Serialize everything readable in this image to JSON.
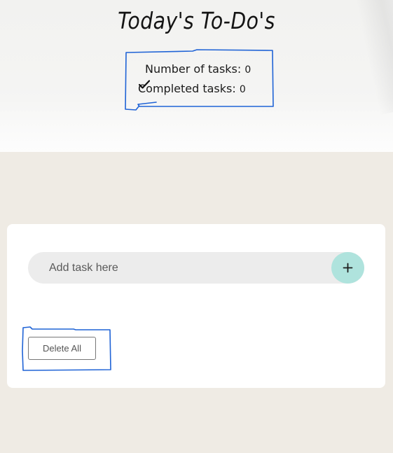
{
  "header": {
    "title": "Today's To-Do's"
  },
  "counters": {
    "total_label": "Number of tasks:",
    "total_value": "0",
    "completed_label": "Completed tasks:",
    "completed_value": "0"
  },
  "task_form": {
    "placeholder": "Add task here",
    "value": "",
    "add_icon": "plus-icon"
  },
  "actions": {
    "delete_all_label": "Delete All"
  },
  "colors": {
    "page_background": "#efebe4",
    "card_background": "#ffffff",
    "input_background": "#ececec",
    "add_button": "#afe3dd",
    "annotation_blue": "#1f63d6"
  }
}
